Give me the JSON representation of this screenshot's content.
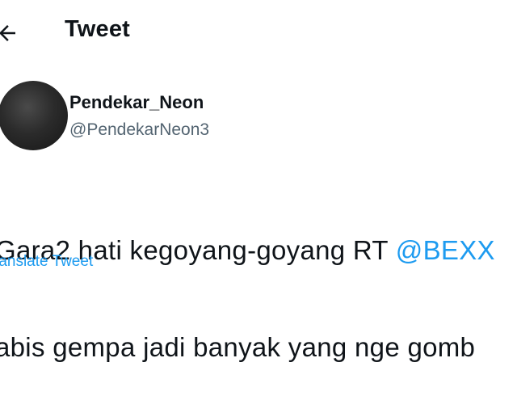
{
  "header": {
    "back_icon": "arrow-left-icon",
    "title": "Tweet"
  },
  "tweet": {
    "author": {
      "display_name": "Pendekar_Neon",
      "handle": "@PendekarNeon3"
    },
    "text": {
      "line1_prefix": "Gara2 hati kegoyang-goyang RT ",
      "line1_mention": "@BEXX",
      "line2": "abis gempa jadi banyak yang nge gomb"
    },
    "translate_label": "ranslate Tweet"
  },
  "colors": {
    "link": "#1d9bf0",
    "text": "#0f1419",
    "secondary": "#536471"
  }
}
